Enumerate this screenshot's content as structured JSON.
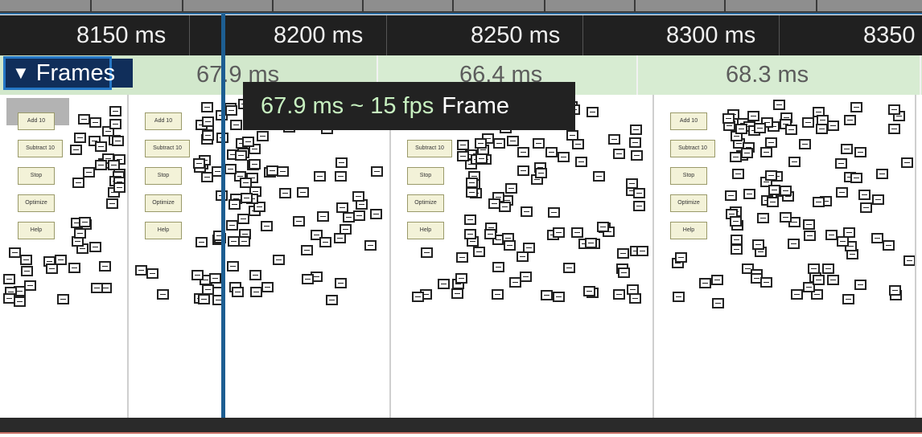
{
  "ruler": {
    "ticks": [
      "8150 ms",
      "8200 ms",
      "8250 ms",
      "8300 ms",
      "8350"
    ]
  },
  "frames_track": {
    "label": "Frames",
    "chevron_icon": "triangle-down-icon",
    "frames": [
      {
        "duration": "67.9 ms"
      },
      {
        "duration": "66.4 ms"
      },
      {
        "duration": "68.3 ms"
      }
    ]
  },
  "tooltip": {
    "duration_fps": "67.9 ms ~ 15 fps",
    "label": "Frame"
  },
  "thumbnail_buttons": [
    "Add 10",
    "Subtract 10",
    "Stop",
    "Optimize",
    "Help"
  ],
  "colors": {
    "ruler_bg": "#202020",
    "frames_bg": "#d7ecd2",
    "label_bg": "#102e5a",
    "playhead": "#1d5e92",
    "tooltip_bg": "#222222"
  }
}
